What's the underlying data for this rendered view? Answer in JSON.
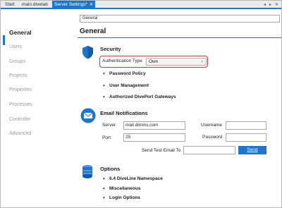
{
  "tabs": [
    {
      "label": "Start",
      "active": false
    },
    {
      "label": "main.divetab",
      "active": false
    },
    {
      "label": "Server Settings*",
      "active": true
    }
  ],
  "tab_close_glyph": "✕",
  "strip_controls": [
    "◂",
    "▸",
    "✕"
  ],
  "sidebar": {
    "items": [
      {
        "label": "General",
        "active": true
      },
      {
        "label": "Users",
        "active": false
      },
      {
        "label": "Groups",
        "active": false
      },
      {
        "label": "Projects",
        "active": false
      },
      {
        "label": "Properties",
        "active": false
      },
      {
        "label": "Processes",
        "active": false
      },
      {
        "label": "Controller",
        "active": false
      },
      {
        "label": "Advanced",
        "active": false
      }
    ]
  },
  "main": {
    "breadcrumb_value": "General",
    "page_title": "General",
    "security": {
      "title": "Security",
      "auth_label": "Authentication Type",
      "auth_value": "Own",
      "expanders": [
        "Password Policy",
        "User Management",
        "Authorized DivePort Gateways"
      ]
    },
    "email": {
      "title": "Email Notifications",
      "server_label": "Server",
      "server_value": "mail.dimins.com",
      "port_label": "Port",
      "port_value": "25",
      "username_label": "Username",
      "username_value": "",
      "password_label": "Password",
      "password_value": "",
      "test_label": "Send Test Email To",
      "test_value": "",
      "send_label": "Send"
    },
    "options": {
      "title": "Options",
      "expanders": [
        "6.4 DiveLine Namespace",
        "Miscellaneous",
        "Login Options"
      ]
    }
  },
  "colors": {
    "accent": "#1e75c9",
    "highlight_border": "#c0393c"
  }
}
